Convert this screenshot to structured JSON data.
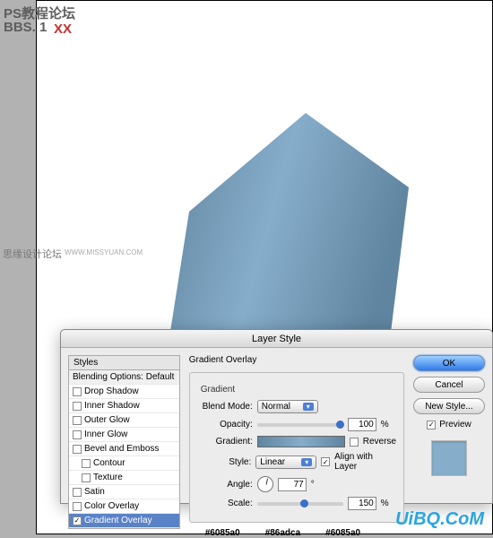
{
  "watermarks": {
    "top_cn": "PS教程论坛",
    "top_bbs": "BBS. 1",
    "top_xx": "XX",
    "side_cn": "思缘设计论坛",
    "side_url": "WWW.MISSYUAN.COM",
    "bottom": "UiBQ.CoM"
  },
  "dialog": {
    "title": "Layer Style",
    "styles_header": "Styles",
    "blending_header": "Blending Options: Default",
    "items": [
      {
        "label": "Drop Shadow",
        "checked": false
      },
      {
        "label": "Inner Shadow",
        "checked": false
      },
      {
        "label": "Outer Glow",
        "checked": false
      },
      {
        "label": "Inner Glow",
        "checked": false
      },
      {
        "label": "Bevel and Emboss",
        "checked": false
      },
      {
        "label": "Contour",
        "checked": false,
        "indent": true
      },
      {
        "label": "Texture",
        "checked": false,
        "indent": true
      },
      {
        "label": "Satin",
        "checked": false
      },
      {
        "label": "Color Overlay",
        "checked": false
      },
      {
        "label": "Gradient Overlay",
        "checked": true,
        "selected": true
      }
    ],
    "panel": {
      "title": "Gradient Overlay",
      "group": "Gradient",
      "blend_mode_label": "Blend Mode:",
      "blend_mode_value": "Normal",
      "opacity_label": "Opacity:",
      "opacity_value": "100",
      "percent": "%",
      "gradient_label": "Gradient:",
      "reverse_label": "Reverse",
      "style_label": "Style:",
      "style_value": "Linear",
      "align_label": "Align with Layer",
      "angle_label": "Angle:",
      "angle_value": "77",
      "degree": "°",
      "scale_label": "Scale:",
      "scale_value": "150",
      "hex1": "#6085a0",
      "hex2": "#86adca",
      "hex3": "#6085a0"
    },
    "buttons": {
      "ok": "OK",
      "cancel": "Cancel",
      "new_style": "New Style...",
      "preview": "Preview"
    }
  }
}
